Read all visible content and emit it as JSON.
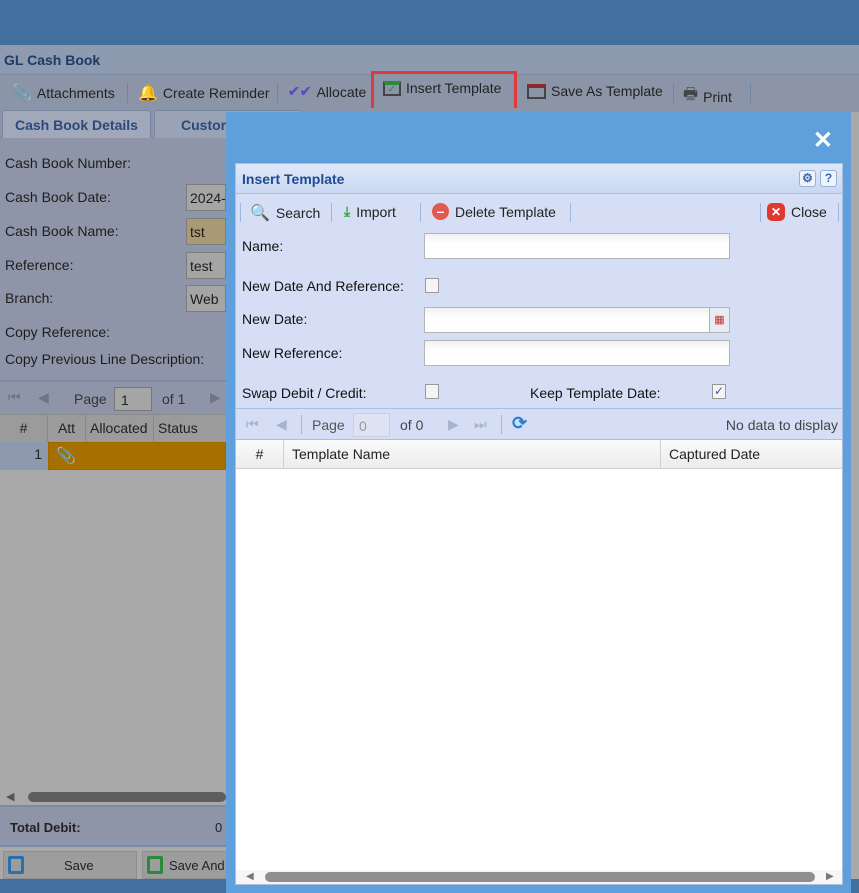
{
  "window": {
    "title": "GL Cash Book"
  },
  "toolbar": {
    "items": [
      {
        "label": "Attachments",
        "icon": "paperclip-icon"
      },
      {
        "label": "Create Reminder",
        "icon": "bell-icon"
      },
      {
        "label": "Allocate",
        "icon": "double-check-icon"
      },
      {
        "label": "Insert Template",
        "icon": "insert-template-icon",
        "highlighted": true
      },
      {
        "label": "Save As Template",
        "icon": "save-template-icon"
      },
      {
        "label": "Print",
        "icon": "printer-icon"
      }
    ]
  },
  "tabs": [
    {
      "label": "Cash Book Details",
      "active": true
    },
    {
      "label": "Custor"
    }
  ],
  "form": {
    "cash_book_number_label": "Cash Book Number:",
    "cash_book_date_label": "Cash Book Date:",
    "cash_book_date_value": "2024-",
    "cash_book_name_label": "Cash Book Name:",
    "cash_book_name_value": "tst",
    "reference_label": "Reference:",
    "reference_value": "test",
    "branch_label": "Branch:",
    "branch_value": "Web",
    "copy_reference_label": "Copy Reference:",
    "copy_prev_line_label": "Copy Previous Line Description:"
  },
  "grid": {
    "pager": {
      "page_label": "Page",
      "page_value": "1",
      "of_label": "of 1"
    },
    "columns": [
      "#",
      "Att",
      "Allocated",
      "Status"
    ],
    "rows": [
      {
        "num": "1"
      }
    ],
    "row_color": "#a66f00"
  },
  "totals": {
    "total_debit_label": "Total Debit:",
    "total_debit_value": "0"
  },
  "buttons": {
    "save": "Save",
    "save_and": "Save And"
  },
  "modal": {
    "title": "Insert Template",
    "toolbar": {
      "search": "Search",
      "import": "Import",
      "delete": "Delete Template",
      "close": "Close"
    },
    "fields": {
      "name_label": "Name:",
      "name_value": "",
      "new_date_ref_label": "New Date And Reference:",
      "new_date_ref_checked": false,
      "new_date_label": "New Date:",
      "new_date_value": "",
      "new_ref_label": "New Reference:",
      "new_ref_value": "",
      "swap_label": "Swap Debit / Credit:",
      "swap_checked": false,
      "keep_date_label": "Keep Template Date:",
      "keep_date_checked": true,
      "check_mark": "✓"
    },
    "pager": {
      "page_label": "Page",
      "page_value": "0",
      "of_label": "of 0",
      "status": "No data to display"
    },
    "columns": [
      "#",
      "Template Name",
      "Captured Date"
    ],
    "accent": "#5fa0dc"
  }
}
